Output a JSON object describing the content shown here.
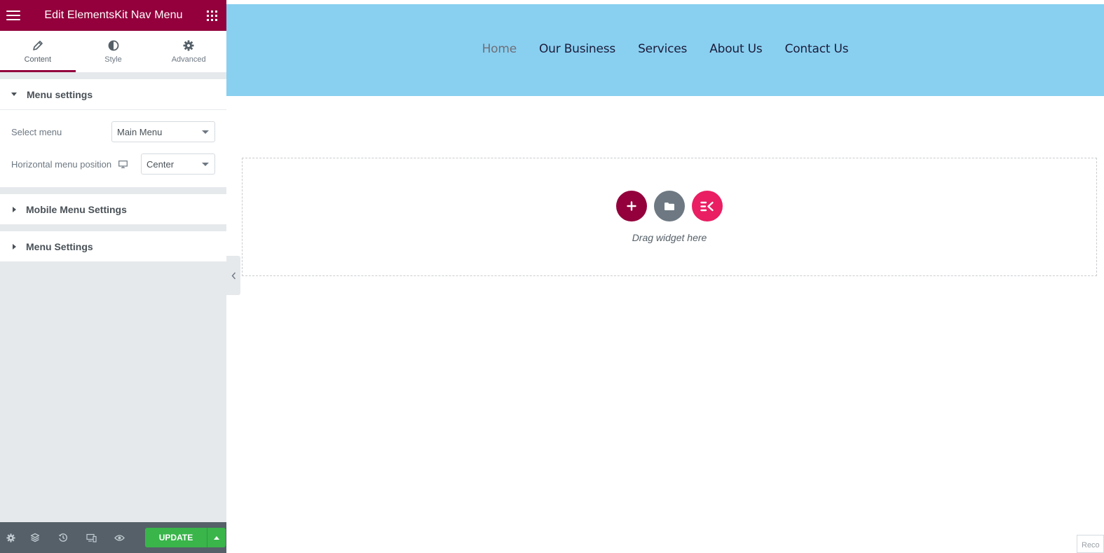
{
  "panel": {
    "header_title": "Edit ElementsKit Nav Menu",
    "tabs": [
      {
        "label": "Content",
        "icon": "pencil-icon",
        "active": true
      },
      {
        "label": "Style",
        "icon": "half-circle-icon",
        "active": false
      },
      {
        "label": "Advanced",
        "icon": "gear-icon",
        "active": false
      }
    ],
    "sections": {
      "menu_settings": {
        "title": "Menu settings",
        "expanded": true,
        "controls": {
          "select_menu": {
            "label": "Select menu",
            "value": "Main Menu"
          },
          "horizontal_position": {
            "label": "Horizontal menu position",
            "value": "Center"
          }
        }
      },
      "mobile_menu_settings": {
        "title": "Mobile Menu Settings",
        "expanded": false
      },
      "menu_settings_2": {
        "title": "Menu Settings",
        "expanded": false
      }
    },
    "footer": {
      "update_label": "UPDATE",
      "icons": [
        "settings-icon",
        "navigator-icon",
        "history-icon",
        "responsive-icon",
        "preview-icon"
      ]
    }
  },
  "preview": {
    "nav_items": [
      {
        "label": "Home",
        "current": true
      },
      {
        "label": "Our Business",
        "current": false
      },
      {
        "label": "Services",
        "current": false
      },
      {
        "label": "About Us",
        "current": false
      },
      {
        "label": "Contact Us",
        "current": false
      }
    ],
    "dropzone_text": "Drag widget here",
    "corner_text": "Reco"
  },
  "colors": {
    "brand": "#93003c",
    "nav_band": "#89cff0",
    "update_green": "#39b54a",
    "ekit_pink": "#e91e63",
    "footer_gray": "#556068"
  }
}
